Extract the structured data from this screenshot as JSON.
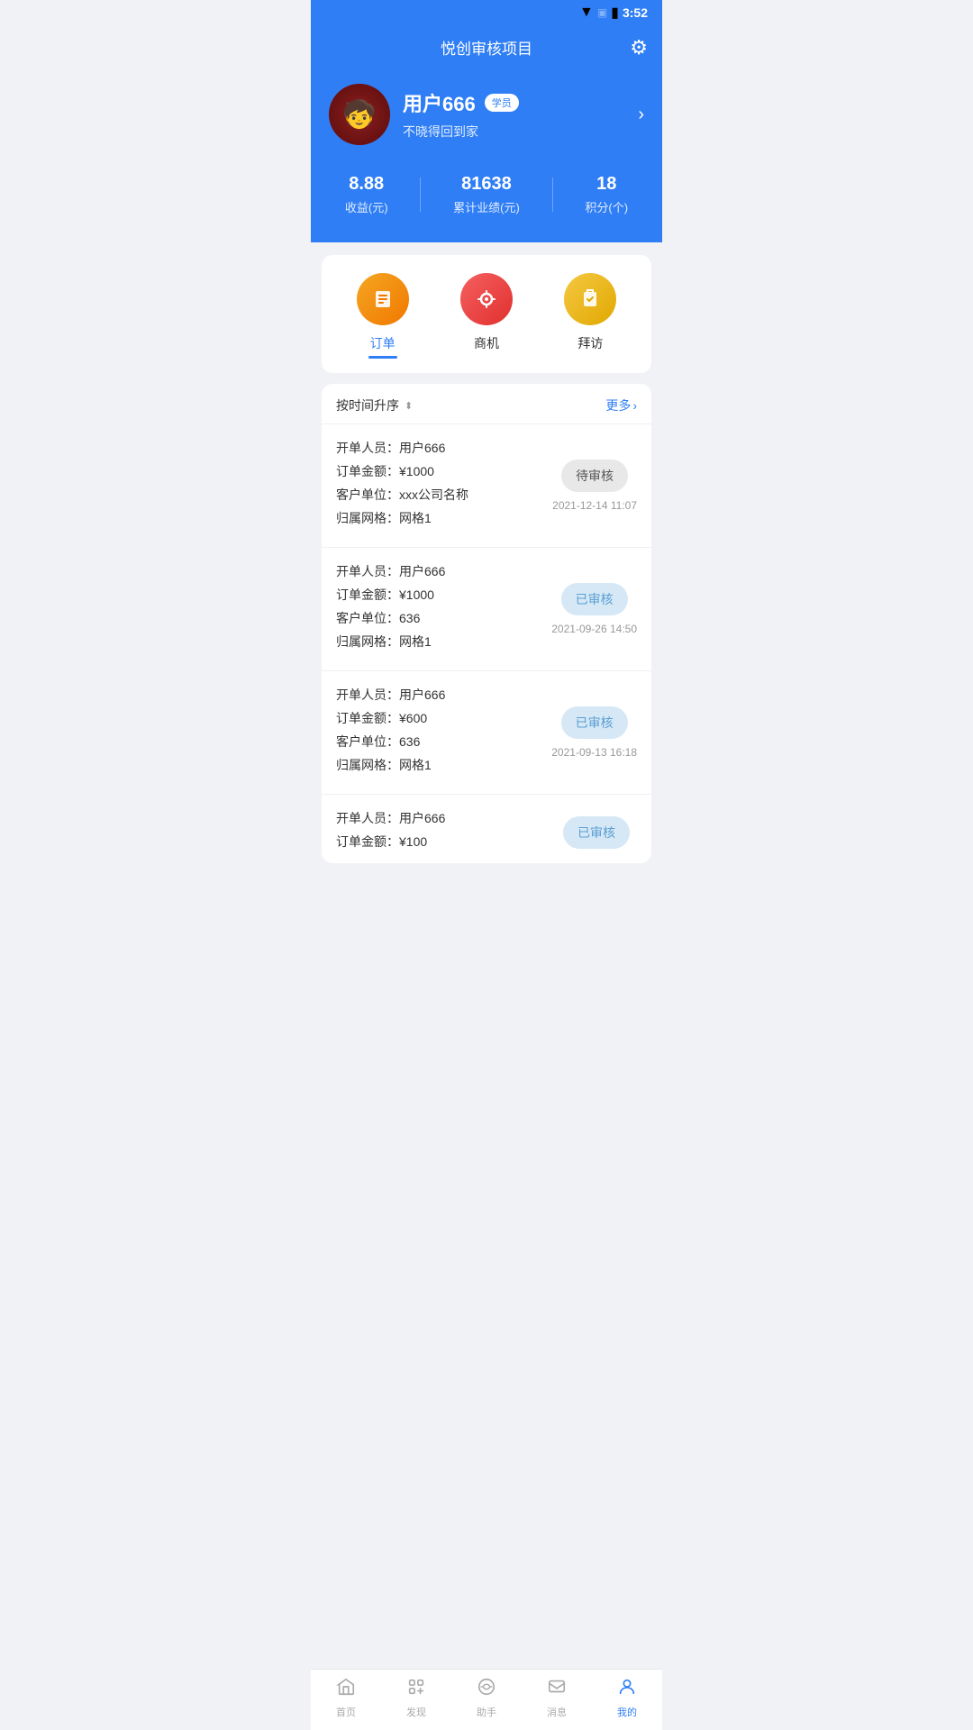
{
  "statusBar": {
    "time": "3:52"
  },
  "header": {
    "title": "悦创审核项目",
    "gearLabel": "设置"
  },
  "profile": {
    "name": "用户666",
    "badge": "学员",
    "subtitle": "不晓得回到家",
    "avatarEmoji": "🧒"
  },
  "stats": [
    {
      "value": "8.88",
      "label": "收益(元)"
    },
    {
      "value": "81638",
      "label": "累计业绩(元)"
    },
    {
      "value": "18",
      "label": "积分(个)"
    }
  ],
  "tabs": [
    {
      "label": "订单",
      "active": true
    },
    {
      "label": "商机",
      "active": false
    },
    {
      "label": "拜访",
      "active": false
    }
  ],
  "listHeader": {
    "sortLabel": "按时间升序",
    "moreLabel": "更多"
  },
  "orders": [
    {
      "opener": "开单人员：用户666",
      "amount": "订单金额：¥1000",
      "client": "客户单位：xxx公司名称",
      "network": "归属网格：网格1",
      "status": "待审核",
      "statusType": "pending",
      "date": "2021-12-14 11:07"
    },
    {
      "opener": "开单人员：用户666",
      "amount": "订单金额：¥1000",
      "client": "客户单位：636",
      "network": "归属网格：网格1",
      "status": "已审核",
      "statusType": "approved",
      "date": "2021-09-26 14:50"
    },
    {
      "opener": "开单人员：用户666",
      "amount": "订单金额：¥600",
      "client": "客户单位：636",
      "network": "归属网格：网格1",
      "status": "已审核",
      "statusType": "approved",
      "date": "2021-09-13 16:18"
    },
    {
      "opener": "开单人员：用户666",
      "amount": "订单金额：¥100",
      "client": "",
      "network": "",
      "status": "已审核",
      "statusType": "approved",
      "date": ""
    }
  ],
  "bottomNav": [
    {
      "label": "首页",
      "active": false,
      "icon": "home"
    },
    {
      "label": "发现",
      "active": false,
      "icon": "discover"
    },
    {
      "label": "助手",
      "active": false,
      "icon": "assistant"
    },
    {
      "label": "消息",
      "active": false,
      "icon": "message"
    },
    {
      "label": "我的",
      "active": true,
      "icon": "profile"
    }
  ]
}
